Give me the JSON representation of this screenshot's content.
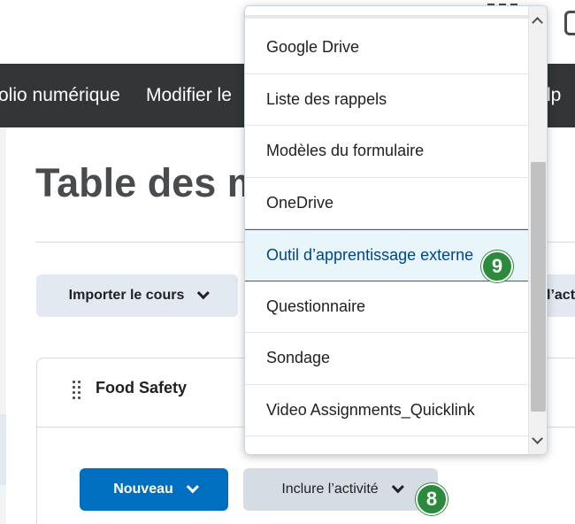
{
  "nav": {
    "item_1": "olio numérique",
    "item_2": "Modifier le",
    "item_3": "lp"
  },
  "page": {
    "title": "Table des m"
  },
  "toolbar": {
    "import_label": "Importer le cours",
    "right_partial_label": "l’acti"
  },
  "module": {
    "title": "Food Safety",
    "new_label": "Nouveau",
    "include_label": "Inclure l’activité"
  },
  "steps": {
    "step_8": "8",
    "step_9": "9"
  },
  "dropdown": {
    "items": [
      "Google Drive",
      "Liste des rappels",
      "Modèles du formulaire",
      "OneDrive",
      "Outil d’apprentissage externe",
      "Questionnaire",
      "Sondage",
      "Video Assignments_Quicklink",
      "Video Assignments_Quicklink"
    ],
    "selected": "Outil d’apprentissage externe"
  },
  "colors": {
    "nav_bg": "#333536",
    "primary": "#006fbf",
    "step_badge": "#2c8a3c",
    "highlight_bg": "#e8f6fc"
  },
  "icons": [
    "grid-icon",
    "chat-icon",
    "chevron-down-icon",
    "drag-handle-icon",
    "scroll-up-icon",
    "scroll-down-icon"
  ]
}
